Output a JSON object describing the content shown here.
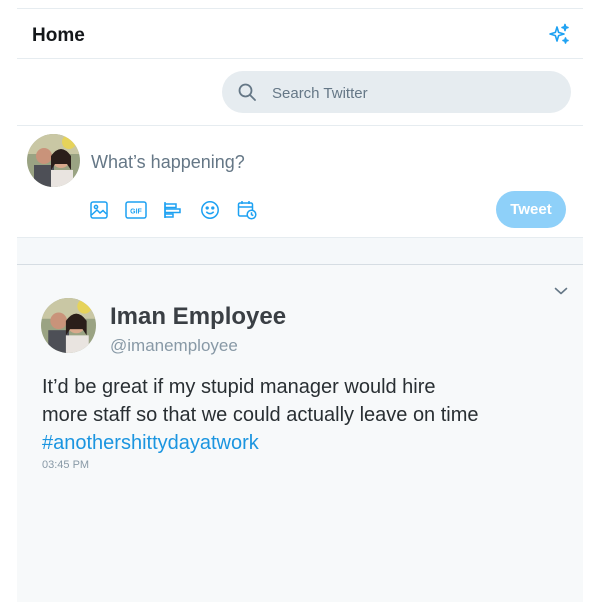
{
  "header": {
    "title": "Home",
    "icon": "sparkle-icon",
    "accent": "#1da1f2"
  },
  "search": {
    "placeholder": "Search Twitter",
    "value": ""
  },
  "composer": {
    "placeholder": "What’s happening?",
    "tools": [
      "image-icon",
      "gif-icon",
      "poll-icon",
      "emoji-icon",
      "schedule-icon"
    ],
    "tweet_label": "Tweet",
    "tweet_button_color": "#8ed0f9"
  },
  "tweet": {
    "name": "Iman Employee",
    "handle": "@imanemployee",
    "text_lines": [
      "It’d be great if my stupid manager would hire",
      "more staff so that we could actually leave on time"
    ],
    "hashtag": "#anothershittydayatwork",
    "time": "03:45 PM",
    "hashtag_color": "#1b95e0"
  }
}
